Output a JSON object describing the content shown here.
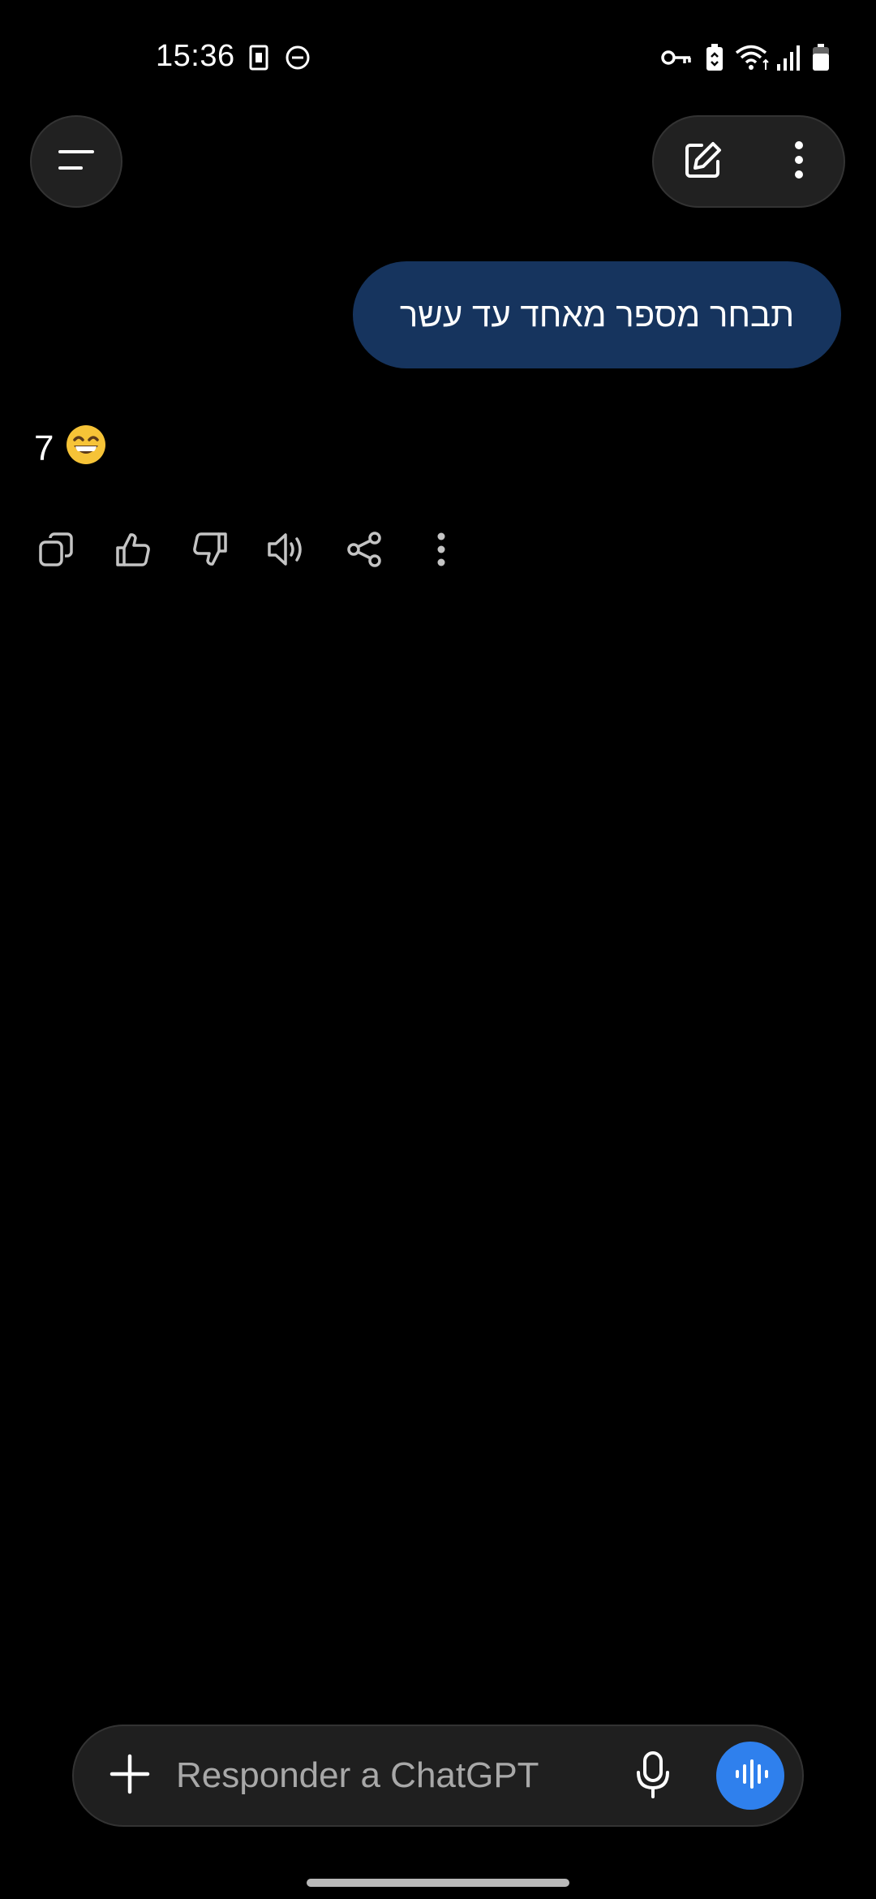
{
  "status_bar": {
    "time": "15:36",
    "left_icons": [
      "sim-card-icon",
      "do-not-disturb-icon"
    ],
    "right_icons": [
      "vpn-key-icon",
      "battery-saver-icon",
      "wifi-icon",
      "signal-icon",
      "battery-icon"
    ]
  },
  "header": {
    "menu_icon": "menu-icon",
    "new_chat_icon": "edit-icon",
    "more_icon": "more-vertical-icon"
  },
  "conversation": {
    "user_message": "תבחר מספר מאחד עד עשר",
    "assistant_reply": "7",
    "assistant_emoji": "😄",
    "actions": [
      "copy-icon",
      "thumbs-up-icon",
      "thumbs-down-icon",
      "speaker-icon",
      "share-icon",
      "more-vertical-icon"
    ]
  },
  "composer": {
    "placeholder": "Responder a ChatGPT",
    "value": "",
    "attach_icon": "plus-icon",
    "mic_icon": "mic-icon",
    "voice_icon": "voice-mode-icon"
  },
  "colors": {
    "background": "#000000",
    "user_bubble": "#16345e",
    "accent": "#2f80ed",
    "surface": "#212121"
  }
}
